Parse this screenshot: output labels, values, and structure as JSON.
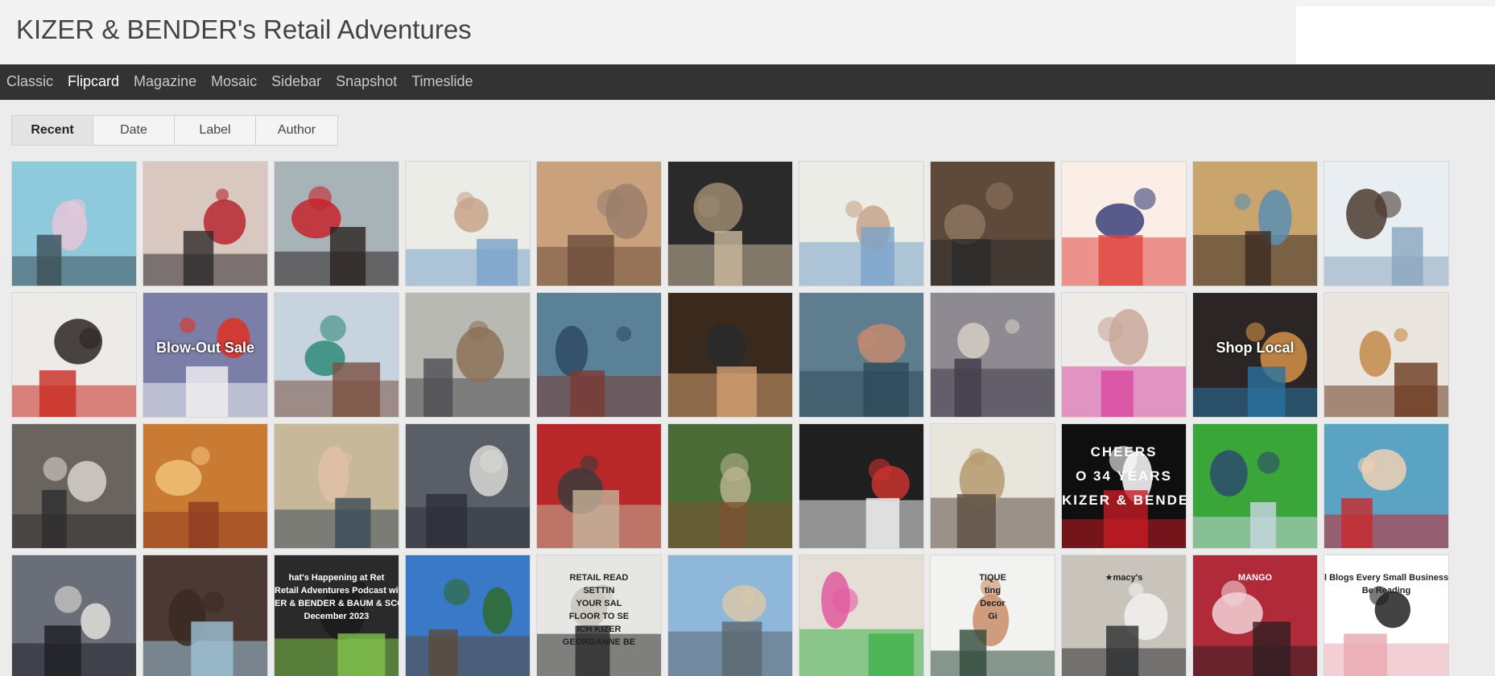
{
  "header": {
    "title": "KIZER & BENDER's Retail Adventures"
  },
  "nav": {
    "items": [
      {
        "label": "Classic",
        "active": false
      },
      {
        "label": "Flipcard",
        "active": true
      },
      {
        "label": "Magazine",
        "active": false
      },
      {
        "label": "Mosaic",
        "active": false
      },
      {
        "label": "Sidebar",
        "active": false
      },
      {
        "label": "Snapshot",
        "active": false
      },
      {
        "label": "Timeslide",
        "active": false
      }
    ]
  },
  "tabs": {
    "items": [
      {
        "label": "Recent",
        "active": true
      },
      {
        "label": "Date",
        "active": false
      },
      {
        "label": "Label",
        "active": false
      },
      {
        "label": "Author",
        "active": false
      }
    ]
  },
  "posts": [
    {
      "scene": "castle-statue",
      "colors": [
        "#8ec9dc",
        "#3c4f57",
        "#e8c6d8"
      ]
    },
    {
      "scene": "holiday-shop",
      "colors": [
        "#d9c8c0",
        "#2e2a2a",
        "#b5272f"
      ]
    },
    {
      "scene": "shopper-gifts",
      "colors": [
        "#a8b3b8",
        "#2a2322",
        "#c8232c"
      ]
    },
    {
      "scene": "cafe-counter",
      "colors": [
        "#ecece6",
        "#7aa3c9",
        "#c8a48a"
      ]
    },
    {
      "scene": "angry-woman",
      "colors": [
        "#c9a17d",
        "#6b4d3c",
        "#9a7e6b"
      ]
    },
    {
      "scene": "video-call",
      "colors": [
        "#2a2a2a",
        "#cbb89e",
        "#9c8a70"
      ]
    },
    {
      "scene": "cafe-counter",
      "colors": [
        "#ecece6",
        "#7aa3c9",
        "#c8a48a"
      ]
    },
    {
      "scene": "bookstore",
      "colors": [
        "#5e4a3a",
        "#2b2b2b",
        "#8d7560"
      ]
    },
    {
      "scene": "illustration",
      "colors": [
        "#fbeee6",
        "#e0453f",
        "#3b3f7a"
      ]
    },
    {
      "scene": "store-aisle",
      "colors": [
        "#c9a46d",
        "#3b2a22",
        "#5c8fb2"
      ]
    },
    {
      "scene": "laptop-people",
      "colors": [
        "#e8eef2",
        "#8aa6bf",
        "#4b3b30"
      ]
    },
    {
      "scene": "portrait-pair",
      "colors": [
        "#ecebe8",
        "#c92a20",
        "#2b2522"
      ]
    },
    {
      "scene": "sale-sign",
      "colors": [
        "#7b7fa8",
        "#f2f2f2",
        "#e03023"
      ],
      "caption": "Blow-Out Sale"
    },
    {
      "scene": "storefront",
      "colors": [
        "#c7d3df",
        "#7a5040",
        "#2f8a7a"
      ]
    },
    {
      "scene": "street-crowd",
      "colors": [
        "#b9b9b4",
        "#4d4d52",
        "#8b7158"
      ]
    },
    {
      "scene": "hats",
      "colors": [
        "#5a8196",
        "#7a3a33",
        "#2e4a64"
      ]
    },
    {
      "scene": "two-men",
      "colors": [
        "#3a2a1e",
        "#d1a070",
        "#2a2a2a"
      ]
    },
    {
      "scene": "boutique-shopper",
      "colors": [
        "#5e7d8f",
        "#2e4a5a",
        "#c28870"
      ]
    },
    {
      "scene": "window-display",
      "colors": [
        "#8e8a92",
        "#403c48",
        "#d6cec4"
      ]
    },
    {
      "scene": "tablet",
      "colors": [
        "#ecebe8",
        "#d94aa0",
        "#c9a99a"
      ]
    },
    {
      "scene": "shop-local",
      "colors": [
        "#2b2525",
        "#2a72a0",
        "#d39248"
      ],
      "caption": "Shop Local"
    },
    {
      "scene": "handbag-store",
      "colors": [
        "#eae5de",
        "#6b3a1f",
        "#c28b4a"
      ]
    },
    {
      "scene": "clothing-rack",
      "colors": [
        "#6a645e",
        "#2e2c2e",
        "#d8d2cc"
      ]
    },
    {
      "scene": "gift-shop",
      "colors": [
        "#c97b33",
        "#8f3b20",
        "#f1c27a"
      ]
    },
    {
      "scene": "selfie",
      "colors": [
        "#c8b89a",
        "#3b4a58",
        "#e0c0a5"
      ]
    },
    {
      "scene": "gray-storefront",
      "colors": [
        "#5a5e66",
        "#2c3038",
        "#d8d8d4"
      ]
    },
    {
      "scene": "red-office",
      "colors": [
        "#b8282a",
        "#c4b29a",
        "#3b3b3b"
      ]
    },
    {
      "scene": "green-wall",
      "colors": [
        "#4a6b36",
        "#7a5232",
        "#b7b28e"
      ]
    },
    {
      "scene": "sephora",
      "colors": [
        "#1f1f1f",
        "#f2f2f2",
        "#c8322e"
      ]
    },
    {
      "scene": "group-photo",
      "colors": [
        "#e8e5dd",
        "#5b4d42",
        "#b59b6e"
      ]
    },
    {
      "scene": "cheers",
      "colors": [
        "#0f0f10",
        "#c61c24",
        "#ffffff"
      ],
      "caption_lines": [
        "CHEERS",
        "O 34 YEARS",
        "KIZER & BENDER"
      ]
    },
    {
      "scene": "green-car",
      "colors": [
        "#3aa63a",
        "#c8d6e2",
        "#2d4a6b"
      ]
    },
    {
      "scene": "red-sweater",
      "colors": [
        "#5aa3c3",
        "#c9282e",
        "#f0d0b5"
      ]
    },
    {
      "scene": "convention-group",
      "colors": [
        "#6a6e78",
        "#1e1e24",
        "#e3e0da"
      ]
    },
    {
      "scene": "blue-shirt",
      "colors": [
        "#4a3a33",
        "#9fc3d8",
        "#3b2a22"
      ]
    },
    {
      "scene": "podcast",
      "colors": [
        "#2a2a2a",
        "#7fc24a",
        "#1b1b1b"
      ],
      "caption_lines": [
        "hat's Happening at Ret",
        "Retail Adventures Podcast with",
        "ER & BENDER & BAUM & SCOTT &",
        "December 2023"
      ]
    },
    {
      "scene": "victorian-house",
      "colors": [
        "#3a78c8",
        "#5a4a3c",
        "#2f6b2a"
      ]
    },
    {
      "scene": "book-cover",
      "colors": [
        "#e6e6e4",
        "#2a2a2a",
        "#c8c4bc"
      ],
      "caption_lines": [
        "RETAIL READ",
        "SETTIN",
        "YOUR SAL",
        "FLOOR TO SE",
        "ICH KIZER",
        "GEORGANNE BE"
      ]
    },
    {
      "scene": "city-street",
      "colors": [
        "#8fb7d9",
        "#5b6670",
        "#d8c8aa"
      ]
    },
    {
      "scene": "shopping-bags",
      "colors": [
        "#e4ded6",
        "#3fb24a",
        "#e25aa0"
      ]
    },
    {
      "scene": "decor-magazine",
      "colors": [
        "#f2f2f0",
        "#2f4a3a",
        "#c98e6a"
      ],
      "caption_lines": [
        "TIQUE",
        "ting",
        "Decor",
        "Gi"
      ]
    },
    {
      "scene": "macys",
      "colors": [
        "#c8c4bc",
        "#2c2e30",
        "#f2f2f0"
      ],
      "caption_lines": [
        "★macy's"
      ]
    },
    {
      "scene": "mango-window",
      "colors": [
        "#b02a3a",
        "#2e1e22",
        "#f2d2d6"
      ],
      "caption_lines": [
        "MANGO"
      ]
    },
    {
      "scene": "blog-graphic",
      "colors": [
        "#ffffff",
        "#e8a8b0",
        "#222222"
      ],
      "caption_lines": [
        "l Blogs Every Small Business Ow",
        "Be Reading"
      ]
    }
  ]
}
